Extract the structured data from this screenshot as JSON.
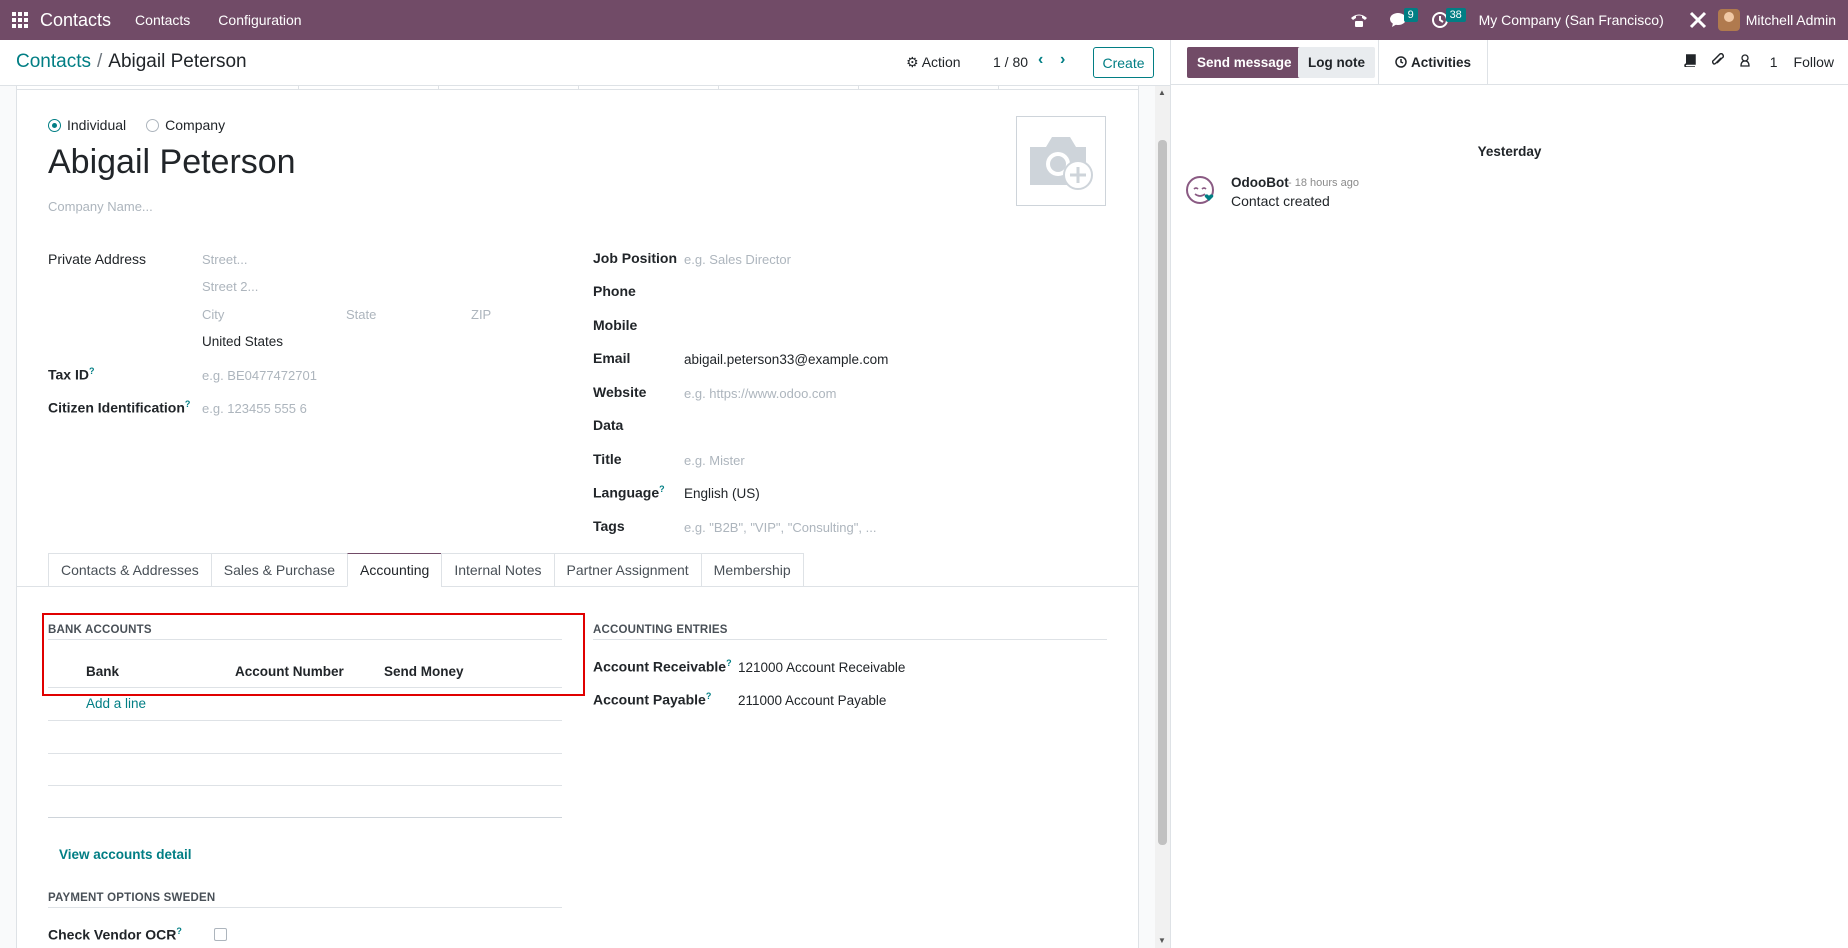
{
  "navbar": {
    "app_name": "Contacts",
    "menus": [
      "Contacts",
      "Configuration"
    ],
    "messages_badge": "9",
    "activities_badge": "38",
    "company": "My Company (San Francisco)",
    "user": "Mitchell Admin",
    "brand_color": "#714b67"
  },
  "control": {
    "breadcrumb_parent": "Contacts",
    "breadcrumb_sep": "/",
    "breadcrumb_current": "Abigail Peterson",
    "action_label": "Action",
    "pager": "1 / 80",
    "create_label": "Create"
  },
  "form": {
    "type_options": [
      "Individual",
      "Company"
    ],
    "type_selected": "Individual",
    "name": "Abigail Peterson",
    "company_placeholder": "Company Name...",
    "left_fields": {
      "private_address_label": "Private Address",
      "street_ph": "Street...",
      "street2_ph": "Street 2...",
      "city_ph": "City",
      "state_ph": "State",
      "zip_ph": "ZIP",
      "country": "United States",
      "tax_id_label": "Tax ID",
      "tax_id_ph": "e.g. BE0477472701",
      "citizen_label": "Citizen Identification",
      "citizen_ph": "e.g. 123455 555 6"
    },
    "right_fields": {
      "job_label": "Job Position",
      "job_ph": "e.g. Sales Director",
      "phone_label": "Phone",
      "mobile_label": "Mobile",
      "email_label": "Email",
      "email_value": "abigail.peterson33@example.com",
      "website_label": "Website",
      "website_ph": "e.g. https://www.odoo.com",
      "data_label": "Data",
      "title_label": "Title",
      "title_ph": "e.g. Mister",
      "language_label": "Language",
      "language_value": "English (US)",
      "tags_label": "Tags",
      "tags_ph": "e.g. \"B2B\", \"VIP\", \"Consulting\", ..."
    },
    "help_mark": "?",
    "tabs": [
      "Contacts & Addresses",
      "Sales & Purchase",
      "Accounting",
      "Internal Notes",
      "Partner Assignment",
      "Membership"
    ],
    "active_tab": "Accounting"
  },
  "accounting": {
    "bank_title": "BANK ACCOUNTS",
    "columns": [
      "Bank",
      "Account Number",
      "Send Money"
    ],
    "add_line": "Add a line",
    "view_detail": "View accounts detail",
    "payment_title": "PAYMENT OPTIONS SWEDEN",
    "check_vendor_label": "Check Vendor OCR",
    "check_vendor_checked": false,
    "entries_title": "ACCOUNTING ENTRIES",
    "receivable_label": "Account Receivable",
    "receivable_value": "121000 Account Receivable",
    "payable_label": "Account Payable",
    "payable_value": "211000 Account Payable"
  },
  "chatter": {
    "send_message": "Send message",
    "log_note": "Log note",
    "activities": "Activities",
    "followers_count": "1",
    "follow": "Follow",
    "day": "Yesterday",
    "message": {
      "author": "OdooBot",
      "time": "- 18 hours ago",
      "body": "Contact created"
    }
  }
}
